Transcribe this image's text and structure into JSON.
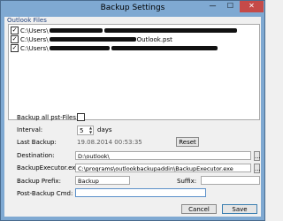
{
  "window": {
    "title": "Backup Settings",
    "min": "—",
    "max": "☐",
    "close": "✕"
  },
  "files": {
    "group_label": "Outlook Files",
    "items": [
      {
        "checked": true,
        "prefix": "C:\\Users\\",
        "suffix": ""
      },
      {
        "checked": true,
        "prefix": "C:\\Users\\",
        "suffix": "Outlook.pst"
      },
      {
        "checked": true,
        "prefix": "C:\\Users\\",
        "suffix": ""
      }
    ]
  },
  "form": {
    "backup_all_label": "Backup all pst-Files:",
    "interval_label": "Interval:",
    "interval_value": "5",
    "interval_unit": "days",
    "last_backup_label": "Last Backup:",
    "last_backup_value": "19.08.2014 00:53:35",
    "reset_label": "Reset",
    "destination_label": "Destination:",
    "destination_value": "D:\\outlook\\",
    "browse_label": "...",
    "executor_label": "BackupExecutor.exe:",
    "executor_value": "C:\\programs\\outlookbackupaddin\\BackupExecutor.exe",
    "prefix_label": "Backup Prefix:",
    "prefix_value": "Backup_",
    "suffix_label": "Suffix:",
    "suffix_value": "",
    "postcmd_label": "Post-Backup Cmd:",
    "postcmd_value": ""
  },
  "buttons": {
    "cancel": "Cancel",
    "save": "Save"
  }
}
